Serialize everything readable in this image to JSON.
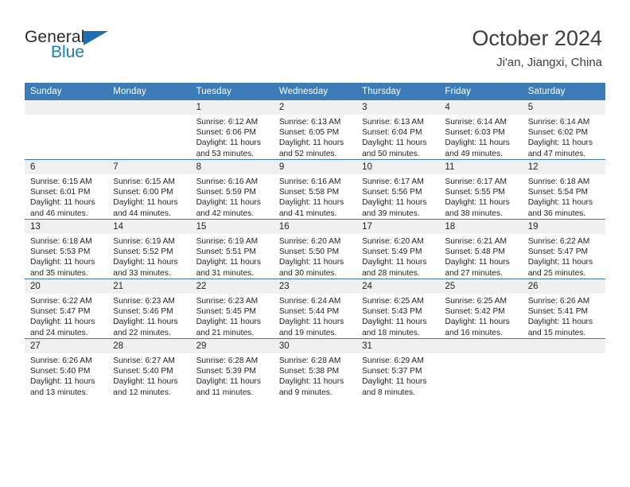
{
  "brand": {
    "name_top": "General",
    "name_bottom": "Blue",
    "color_blue": "#1b6db5",
    "color_dark": "#2b2b2b"
  },
  "header": {
    "title": "October 2024",
    "subtitle": "Ji'an, Jiangxi, China",
    "accent_color": "#3b7cb8"
  },
  "weekdays": [
    "Sunday",
    "Monday",
    "Tuesday",
    "Wednesday",
    "Thursday",
    "Friday",
    "Saturday"
  ],
  "labels": {
    "sunrise": "Sunrise:",
    "sunset": "Sunset:",
    "daylight": "Daylight:"
  },
  "weeks": [
    [
      {
        "day": "",
        "blank": true
      },
      {
        "day": "",
        "blank": true
      },
      {
        "day": "1",
        "sunrise": "Sunrise: 6:12 AM",
        "sunset": "Sunset: 6:06 PM",
        "daylight_1": "Daylight: 11 hours",
        "daylight_2": "and 53 minutes."
      },
      {
        "day": "2",
        "sunrise": "Sunrise: 6:13 AM",
        "sunset": "Sunset: 6:05 PM",
        "daylight_1": "Daylight: 11 hours",
        "daylight_2": "and 52 minutes."
      },
      {
        "day": "3",
        "sunrise": "Sunrise: 6:13 AM",
        "sunset": "Sunset: 6:04 PM",
        "daylight_1": "Daylight: 11 hours",
        "daylight_2": "and 50 minutes."
      },
      {
        "day": "4",
        "sunrise": "Sunrise: 6:14 AM",
        "sunset": "Sunset: 6:03 PM",
        "daylight_1": "Daylight: 11 hours",
        "daylight_2": "and 49 minutes."
      },
      {
        "day": "5",
        "sunrise": "Sunrise: 6:14 AM",
        "sunset": "Sunset: 6:02 PM",
        "daylight_1": "Daylight: 11 hours",
        "daylight_2": "and 47 minutes."
      }
    ],
    [
      {
        "day": "6",
        "sunrise": "Sunrise: 6:15 AM",
        "sunset": "Sunset: 6:01 PM",
        "daylight_1": "Daylight: 11 hours",
        "daylight_2": "and 46 minutes."
      },
      {
        "day": "7",
        "sunrise": "Sunrise: 6:15 AM",
        "sunset": "Sunset: 6:00 PM",
        "daylight_1": "Daylight: 11 hours",
        "daylight_2": "and 44 minutes."
      },
      {
        "day": "8",
        "sunrise": "Sunrise: 6:16 AM",
        "sunset": "Sunset: 5:59 PM",
        "daylight_1": "Daylight: 11 hours",
        "daylight_2": "and 42 minutes."
      },
      {
        "day": "9",
        "sunrise": "Sunrise: 6:16 AM",
        "sunset": "Sunset: 5:58 PM",
        "daylight_1": "Daylight: 11 hours",
        "daylight_2": "and 41 minutes."
      },
      {
        "day": "10",
        "sunrise": "Sunrise: 6:17 AM",
        "sunset": "Sunset: 5:56 PM",
        "daylight_1": "Daylight: 11 hours",
        "daylight_2": "and 39 minutes."
      },
      {
        "day": "11",
        "sunrise": "Sunrise: 6:17 AM",
        "sunset": "Sunset: 5:55 PM",
        "daylight_1": "Daylight: 11 hours",
        "daylight_2": "and 38 minutes."
      },
      {
        "day": "12",
        "sunrise": "Sunrise: 6:18 AM",
        "sunset": "Sunset: 5:54 PM",
        "daylight_1": "Daylight: 11 hours",
        "daylight_2": "and 36 minutes."
      }
    ],
    [
      {
        "day": "13",
        "sunrise": "Sunrise: 6:18 AM",
        "sunset": "Sunset: 5:53 PM",
        "daylight_1": "Daylight: 11 hours",
        "daylight_2": "and 35 minutes."
      },
      {
        "day": "14",
        "sunrise": "Sunrise: 6:19 AM",
        "sunset": "Sunset: 5:52 PM",
        "daylight_1": "Daylight: 11 hours",
        "daylight_2": "and 33 minutes."
      },
      {
        "day": "15",
        "sunrise": "Sunrise: 6:19 AM",
        "sunset": "Sunset: 5:51 PM",
        "daylight_1": "Daylight: 11 hours",
        "daylight_2": "and 31 minutes."
      },
      {
        "day": "16",
        "sunrise": "Sunrise: 6:20 AM",
        "sunset": "Sunset: 5:50 PM",
        "daylight_1": "Daylight: 11 hours",
        "daylight_2": "and 30 minutes."
      },
      {
        "day": "17",
        "sunrise": "Sunrise: 6:20 AM",
        "sunset": "Sunset: 5:49 PM",
        "daylight_1": "Daylight: 11 hours",
        "daylight_2": "and 28 minutes."
      },
      {
        "day": "18",
        "sunrise": "Sunrise: 6:21 AM",
        "sunset": "Sunset: 5:48 PM",
        "daylight_1": "Daylight: 11 hours",
        "daylight_2": "and 27 minutes."
      },
      {
        "day": "19",
        "sunrise": "Sunrise: 6:22 AM",
        "sunset": "Sunset: 5:47 PM",
        "daylight_1": "Daylight: 11 hours",
        "daylight_2": "and 25 minutes."
      }
    ],
    [
      {
        "day": "20",
        "sunrise": "Sunrise: 6:22 AM",
        "sunset": "Sunset: 5:47 PM",
        "daylight_1": "Daylight: 11 hours",
        "daylight_2": "and 24 minutes."
      },
      {
        "day": "21",
        "sunrise": "Sunrise: 6:23 AM",
        "sunset": "Sunset: 5:46 PM",
        "daylight_1": "Daylight: 11 hours",
        "daylight_2": "and 22 minutes."
      },
      {
        "day": "22",
        "sunrise": "Sunrise: 6:23 AM",
        "sunset": "Sunset: 5:45 PM",
        "daylight_1": "Daylight: 11 hours",
        "daylight_2": "and 21 minutes."
      },
      {
        "day": "23",
        "sunrise": "Sunrise: 6:24 AM",
        "sunset": "Sunset: 5:44 PM",
        "daylight_1": "Daylight: 11 hours",
        "daylight_2": "and 19 minutes."
      },
      {
        "day": "24",
        "sunrise": "Sunrise: 6:25 AM",
        "sunset": "Sunset: 5:43 PM",
        "daylight_1": "Daylight: 11 hours",
        "daylight_2": "and 18 minutes."
      },
      {
        "day": "25",
        "sunrise": "Sunrise: 6:25 AM",
        "sunset": "Sunset: 5:42 PM",
        "daylight_1": "Daylight: 11 hours",
        "daylight_2": "and 16 minutes."
      },
      {
        "day": "26",
        "sunrise": "Sunrise: 6:26 AM",
        "sunset": "Sunset: 5:41 PM",
        "daylight_1": "Daylight: 11 hours",
        "daylight_2": "and 15 minutes."
      }
    ],
    [
      {
        "day": "27",
        "sunrise": "Sunrise: 6:26 AM",
        "sunset": "Sunset: 5:40 PM",
        "daylight_1": "Daylight: 11 hours",
        "daylight_2": "and 13 minutes."
      },
      {
        "day": "28",
        "sunrise": "Sunrise: 6:27 AM",
        "sunset": "Sunset: 5:40 PM",
        "daylight_1": "Daylight: 11 hours",
        "daylight_2": "and 12 minutes."
      },
      {
        "day": "29",
        "sunrise": "Sunrise: 6:28 AM",
        "sunset": "Sunset: 5:39 PM",
        "daylight_1": "Daylight: 11 hours",
        "daylight_2": "and 11 minutes."
      },
      {
        "day": "30",
        "sunrise": "Sunrise: 6:28 AM",
        "sunset": "Sunset: 5:38 PM",
        "daylight_1": "Daylight: 11 hours",
        "daylight_2": "and 9 minutes."
      },
      {
        "day": "31",
        "sunrise": "Sunrise: 6:29 AM",
        "sunset": "Sunset: 5:37 PM",
        "daylight_1": "Daylight: 11 hours",
        "daylight_2": "and 8 minutes."
      },
      {
        "day": "",
        "blank": true
      },
      {
        "day": "",
        "blank": true
      }
    ]
  ]
}
